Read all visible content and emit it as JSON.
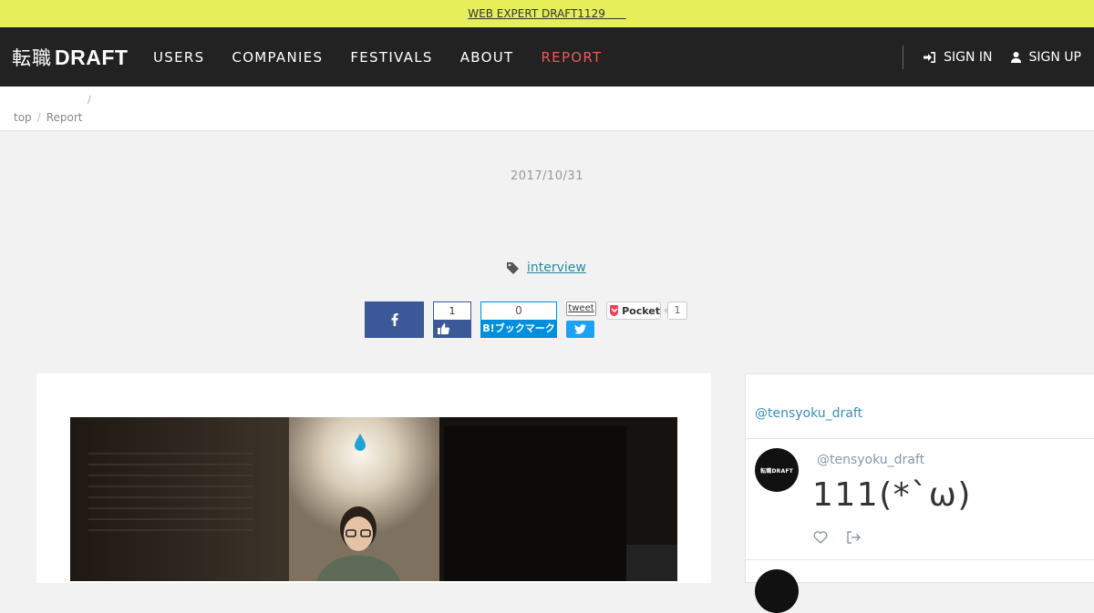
{
  "announcement": {
    "text": "WEB EXPERT DRAFT1129      "
  },
  "navbar": {
    "logo_jp": "転職",
    "logo_en": "DRAFT",
    "links": [
      "USERS",
      "COMPANIES",
      "FESTIVALS",
      "ABOUT",
      "REPORT"
    ],
    "sign_in": "SIGN IN",
    "sign_up": "SIGN UP",
    "active_color": "#e85a5a"
  },
  "breadcrumb": {
    "separator": "/",
    "items": [
      "top",
      "Report"
    ]
  },
  "article": {
    "date": "2017/10/31",
    "tag": "interview"
  },
  "share": {
    "facebook_icon": "facebook-icon",
    "like_count": "1",
    "hatena_count": "0",
    "hatena_label": "B!ブックマーク",
    "tweet_label": "tweet",
    "pocket_label": "Pocket",
    "pocket_count": "1"
  },
  "sidebar": {
    "handle": "@tensyoku_draft",
    "tweet": {
      "user": "@tensyoku_draft",
      "text": "111(*`ω)",
      "avatar_label": "転職DRAFT"
    }
  },
  "colors": {
    "announce_bg": "#e6ef5a",
    "navbar_bg": "#222222",
    "facebook": "#3b5998",
    "hatena": "#008fde",
    "twitter": "#1da1f2",
    "link": "#2a8aa3"
  }
}
